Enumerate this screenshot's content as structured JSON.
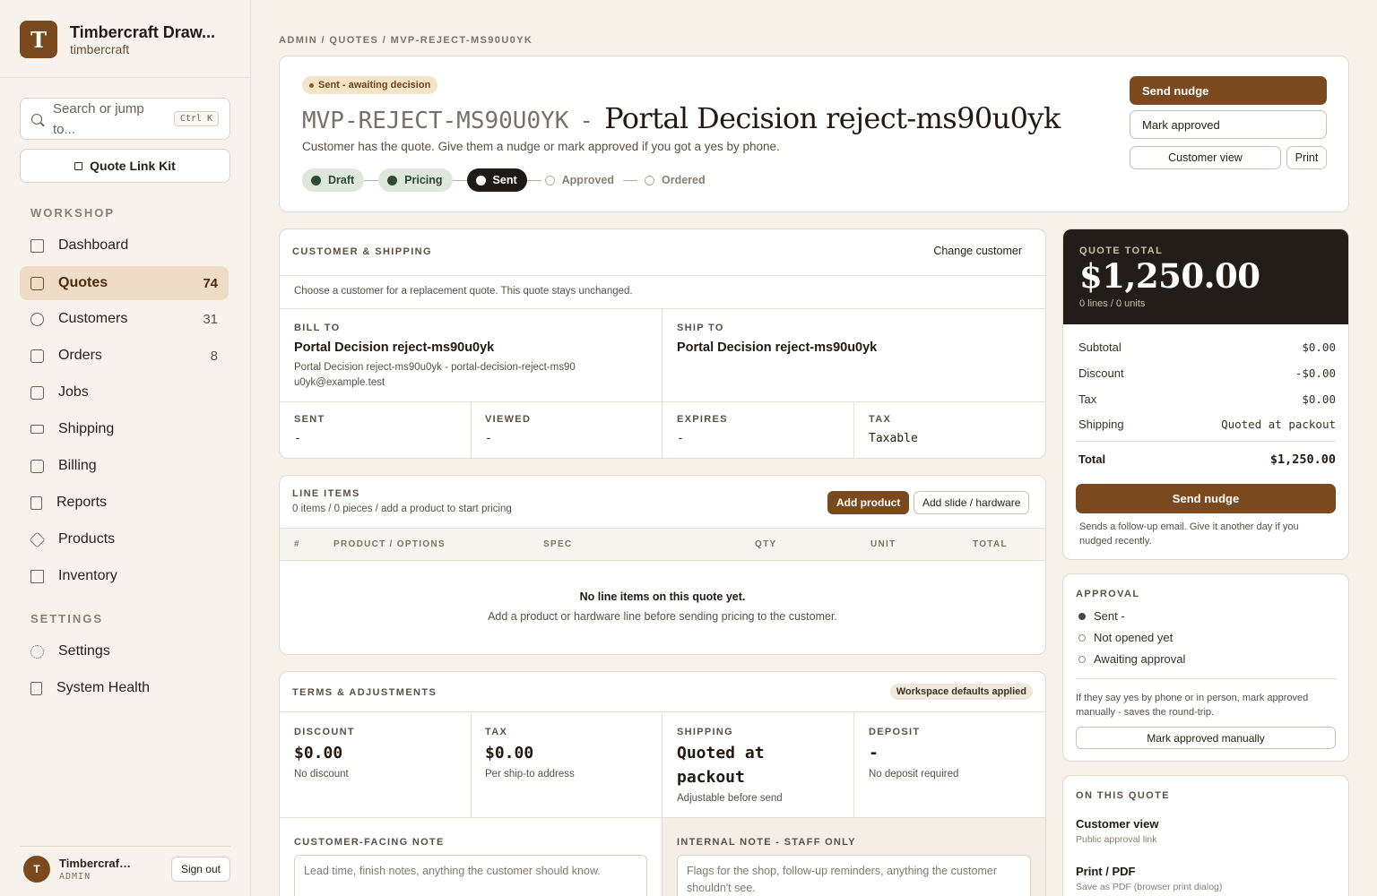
{
  "brand": {
    "initial": "T",
    "name": "Timbercraft Draw...",
    "slug": "timbercraft"
  },
  "search": {
    "placeholder": "Search or jump to...",
    "shortcut": "Ctrl K"
  },
  "quote_link_kit": "Quote Link Kit",
  "nav": {
    "workshop_label": "WORKSHOP",
    "settings_label": "SETTINGS",
    "items": [
      {
        "label": "Dashboard",
        "count": ""
      },
      {
        "label": "Quotes",
        "count": "74"
      },
      {
        "label": "Customers",
        "count": "31"
      },
      {
        "label": "Orders",
        "count": "8"
      },
      {
        "label": "Jobs",
        "count": ""
      },
      {
        "label": "Shipping",
        "count": ""
      },
      {
        "label": "Billing",
        "count": ""
      },
      {
        "label": "Reports",
        "count": ""
      },
      {
        "label": "Products",
        "count": ""
      },
      {
        "label": "Inventory",
        "count": ""
      }
    ],
    "settings_items": [
      {
        "label": "Settings"
      },
      {
        "label": "System Health"
      }
    ]
  },
  "user": {
    "initial": "T",
    "name": "Timbercraft Ad...",
    "role": "ADMIN",
    "sign_out": "Sign out"
  },
  "breadcrumb": "ADMIN / QUOTES / MVP-REJECT-MS90U0YK",
  "header": {
    "status": "Sent - awaiting decision",
    "code": "MVP-REJECT-MS90U0YK",
    "dash": "-",
    "title": "Portal Decision reject-ms90u0yk",
    "subtitle": "Customer has the quote. Give them a nudge or mark approved if you got a yes by phone.",
    "steps": [
      "Draft",
      "Pricing",
      "Sent",
      "Approved",
      "Ordered"
    ],
    "send_nudge": "Send nudge",
    "mark_approved": "Mark approved",
    "customer_view": "Customer view",
    "print": "Print"
  },
  "customer": {
    "section": "CUSTOMER & SHIPPING",
    "change": "Change customer",
    "notice": "Choose a customer for a replacement quote. This quote stays unchanged.",
    "bill_to_label": "BILL TO",
    "bill_to_name": "Portal Decision reject-ms90u0yk",
    "bill_to_detail": "Portal Decision reject-ms90u0yk - portal-decision-reject-ms90u0yk@example.test",
    "ship_to_label": "SHIP TO",
    "ship_to_name": "Portal Decision reject-ms90u0yk",
    "sent_label": "SENT",
    "sent_value": "-",
    "viewed_label": "VIEWED",
    "viewed_value": "-",
    "expires_label": "EXPIRES",
    "expires_value": "-",
    "tax_label": "TAX",
    "tax_value": "Taxable"
  },
  "line_items": {
    "section": "LINE ITEMS",
    "summary": "0 items / 0 pieces / add a product to start pricing",
    "add_product": "Add product",
    "add_slide": "Add slide / hardware",
    "columns": [
      "#",
      "PRODUCT / OPTIONS",
      "SPEC",
      "QTY",
      "UNIT",
      "TOTAL"
    ],
    "empty_title": "No line items on this quote yet.",
    "empty_sub": "Add a product or hardware line before sending pricing to the customer."
  },
  "terms": {
    "section": "TERMS & ADJUSTMENTS",
    "defaults_badge": "Workspace defaults applied",
    "discount_label": "DISCOUNT",
    "discount_value": "$0.00",
    "discount_sub": "No discount",
    "tax_label": "TAX",
    "tax_value": "$0.00",
    "tax_sub": "Per ship-to address",
    "shipping_label": "SHIPPING",
    "shipping_value": "Quoted at packout",
    "shipping_sub": "Adjustable before send",
    "deposit_label": "DEPOSIT",
    "deposit_value": "-",
    "deposit_sub": "No deposit required",
    "customer_note_label": "CUSTOMER-FACING NOTE",
    "customer_note_placeholder": "Lead time, finish notes, anything the customer should know.",
    "internal_note_label": "INTERNAL NOTE - STAFF ONLY",
    "internal_note_placeholder": "Flags for the shop, follow-up reminders, anything the customer shouldn't see."
  },
  "totals": {
    "label": "QUOTE TOTAL",
    "amount": "$1,250.00",
    "meta": "0 lines / 0 units",
    "rows": [
      {
        "label": "Subtotal",
        "value": "$0.00"
      },
      {
        "label": "Discount",
        "value": "-$0.00"
      },
      {
        "label": "Tax",
        "value": "$0.00"
      },
      {
        "label": "Shipping",
        "value": "Quoted at packout"
      }
    ],
    "total_label": "Total",
    "total_value": "$1,250.00",
    "send_nudge": "Send nudge",
    "nudge_hint": "Sends a follow-up email. Give it another day if you nudged recently."
  },
  "approval": {
    "section": "APPROVAL",
    "steps": [
      "Sent -",
      "Not opened yet",
      "Awaiting approval"
    ],
    "hint": "If they say yes by phone or in person, mark approved manually - saves the round-trip.",
    "button": "Mark approved manually"
  },
  "on_this_quote": {
    "section": "ON THIS QUOTE",
    "customer_view": "Customer view",
    "customer_view_sub": "Public approval link",
    "print_pdf": "Print / PDF",
    "print_pdf_sub": "Save as PDF (browser print dialog)"
  },
  "colors": {
    "accent": "#7a4a1e",
    "dark": "#221d19",
    "active_nav": "#efdcc6",
    "status_pill": "#f7e3c6"
  }
}
